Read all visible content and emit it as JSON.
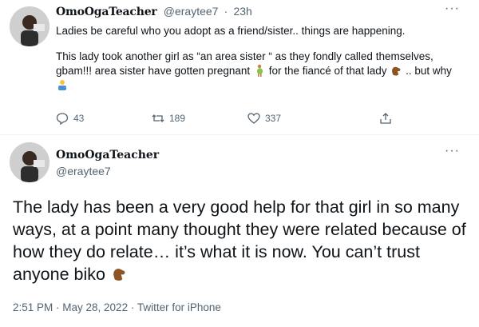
{
  "tweet_top": {
    "display_name": "OmoOgaTeacher",
    "handle": "@eraytee7",
    "separator": "·",
    "time": "23h",
    "more": "···",
    "paragraph_1": "Ladies be careful who you adopt as a friend/sister.. things are happening.",
    "paragraph_2_part_1": "This lady took another girl as “an area sister “ as they fondly called themselves, gbam!!! area sister have gotten pregnant",
    "paragraph_2_part_2": "for the fiancé of that lady",
    "paragraph_2_part_3": ".. but why",
    "reply_count": "43",
    "retweet_count": "189",
    "like_count": "337"
  },
  "tweet_main": {
    "display_name": "OmoOgaTeacher",
    "handle": "@eraytee7",
    "more": "···",
    "text": "The lady has been a very good help for that girl in so many ways, at a point many thought they were related because of how they do relate… it’s what it is now. You can’t trust anyone biko",
    "timestamp": "2:51 PM · May 28, 2022 · Twitter for iPhone"
  },
  "colors": {
    "text": "#0f1419",
    "secondary": "#536471",
    "divider": "#eff3f4"
  },
  "icons": {
    "pregnant": "pregnant-woman-emoji",
    "facepalm_hand": "brown-hand-emoji",
    "shrug": "shrugging-person-emoji"
  }
}
